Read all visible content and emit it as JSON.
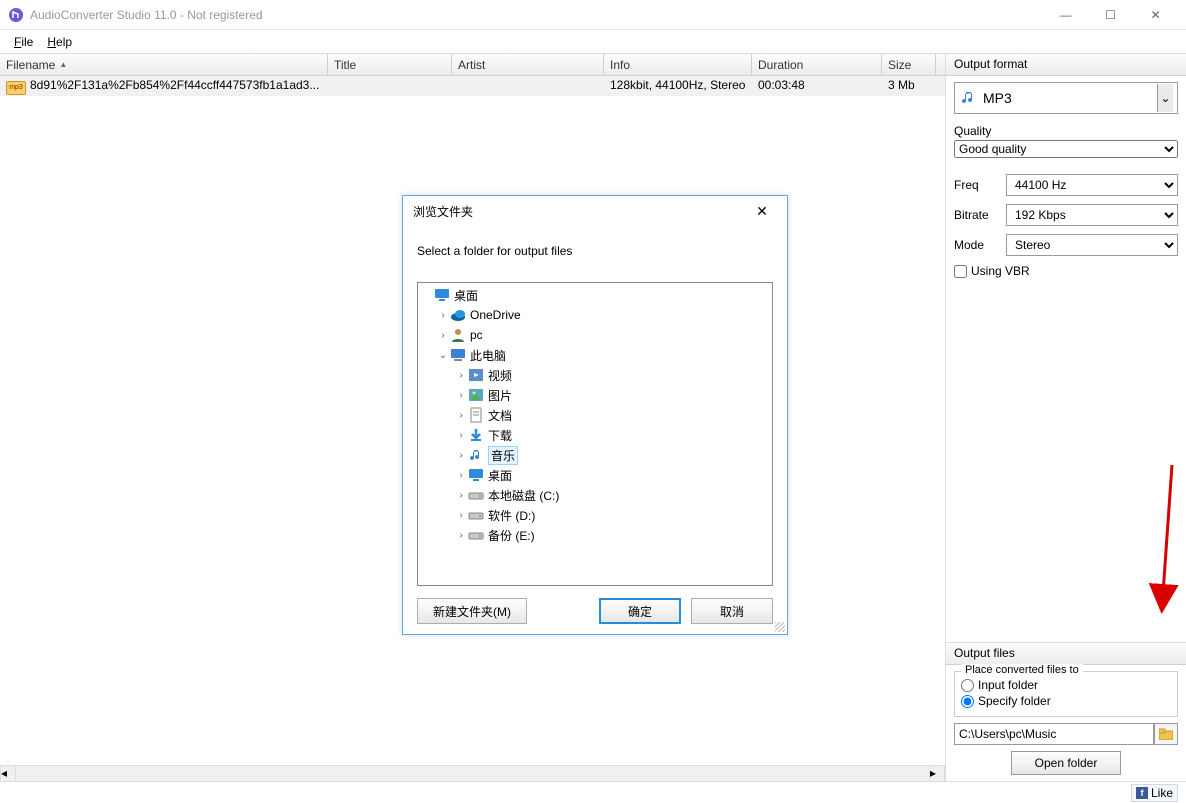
{
  "window": {
    "title": "AudioConverter Studio 11.0 - Not registered"
  },
  "menu": {
    "file": "File",
    "help": "Help"
  },
  "columns": {
    "filename": "Filename",
    "title": "Title",
    "artist": "Artist",
    "info": "Info",
    "duration": "Duration",
    "size": "Size"
  },
  "rows": [
    {
      "icon": "mp3",
      "filename": "8d91%2F131a%2Fb854%2Ff44ccff447573fb1a1ad3...",
      "title": "",
      "artist": "",
      "info": "128kbit, 44100Hz, Stereo",
      "duration": "00:03:48",
      "size": "3 Mb"
    }
  ],
  "right": {
    "output_format_header": "Output format",
    "format_label": "MP3",
    "quality_label": "Quality",
    "quality_value": "Good quality",
    "freq_label": "Freq",
    "freq_value": "44100 Hz",
    "bitrate_label": "Bitrate",
    "bitrate_value": "192 Kbps",
    "mode_label": "Mode",
    "mode_value": "Stereo",
    "using_vbr": "Using VBR",
    "output_files_header": "Output files",
    "group_legend": "Place converted files to",
    "radio_input_folder": "Input folder",
    "radio_specify_folder": "Specify folder",
    "path": "C:\\Users\\pc\\Music",
    "open_folder": "Open folder"
  },
  "statusbar": {
    "like": "Like"
  },
  "dialog": {
    "title": "浏览文件夹",
    "instruction": "Select a folder for output files",
    "tree": [
      {
        "indent": 0,
        "expand": "",
        "icon": "desktop",
        "label": "桌面"
      },
      {
        "indent": 1,
        "expand": "›",
        "icon": "onedrive",
        "label": "OneDrive"
      },
      {
        "indent": 1,
        "expand": "›",
        "icon": "user",
        "label": "pc"
      },
      {
        "indent": 1,
        "expand": "⌄",
        "icon": "pc",
        "label": "此电脑"
      },
      {
        "indent": 2,
        "expand": "›",
        "icon": "video",
        "label": "视频"
      },
      {
        "indent": 2,
        "expand": "›",
        "icon": "pictures",
        "label": "图片"
      },
      {
        "indent": 2,
        "expand": "›",
        "icon": "docs",
        "label": "文档"
      },
      {
        "indent": 2,
        "expand": "›",
        "icon": "download",
        "label": "下载"
      },
      {
        "indent": 2,
        "expand": "›",
        "icon": "music",
        "label": "音乐",
        "selected": true
      },
      {
        "indent": 2,
        "expand": "›",
        "icon": "desktop2",
        "label": "桌面"
      },
      {
        "indent": 2,
        "expand": "›",
        "icon": "drive",
        "label": "本地磁盘 (C:)"
      },
      {
        "indent": 2,
        "expand": "›",
        "icon": "drive",
        "label": "软件 (D:)"
      },
      {
        "indent": 2,
        "expand": "›",
        "icon": "drive",
        "label": "备份 (E:)"
      }
    ],
    "btn_new": "新建文件夹(M)",
    "btn_ok": "确定",
    "btn_cancel": "取消"
  }
}
